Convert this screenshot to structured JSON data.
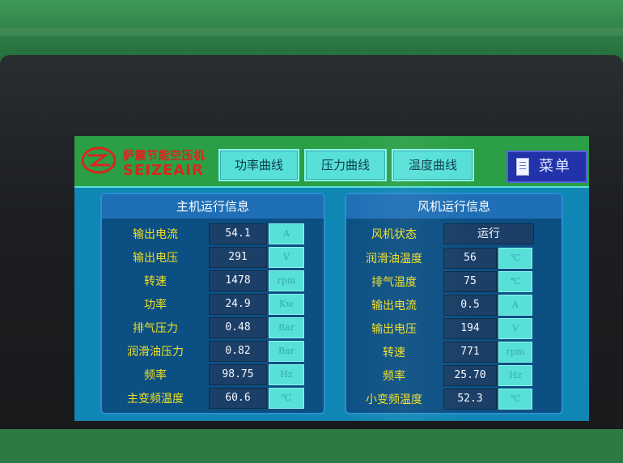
{
  "header": {
    "logo": {
      "cn": "萨震节能空压机",
      "en": "SEIZEAIR"
    },
    "tabs": [
      {
        "label": "功率曲线"
      },
      {
        "label": "压力曲线"
      },
      {
        "label": "温度曲线"
      }
    ],
    "menu_label": "菜单"
  },
  "main_panel": {
    "title": "主机运行信息",
    "rows": [
      {
        "label": "输出电流",
        "value": "54.1",
        "unit": "A"
      },
      {
        "label": "输出电压",
        "value": "291",
        "unit": "V"
      },
      {
        "label": "转速",
        "value": "1478",
        "unit": "rpm"
      },
      {
        "label": "功率",
        "value": "24.9",
        "unit": "Kw"
      },
      {
        "label": "排气压力",
        "value": "0.48",
        "unit": "Bar"
      },
      {
        "label": "润滑油压力",
        "value": "0.82",
        "unit": "Bar"
      },
      {
        "label": "频率",
        "value": "98.75",
        "unit": "Hz"
      },
      {
        "label": "主变频温度",
        "value": "60.6",
        "unit": "℃"
      }
    ]
  },
  "fan_panel": {
    "title": "风机运行信息",
    "status": {
      "label": "风机状态",
      "value": "运行"
    },
    "rows": [
      {
        "label": "润滑油温度",
        "value": "56",
        "unit": "℃"
      },
      {
        "label": "排气温度",
        "value": "75",
        "unit": "℃"
      },
      {
        "label": "输出电流",
        "value": "0.5",
        "unit": "A"
      },
      {
        "label": "输出电压",
        "value": "194",
        "unit": "V"
      },
      {
        "label": "转速",
        "value": "771",
        "unit": "rpm"
      },
      {
        "label": "频率",
        "value": "25.70",
        "unit": "Hz"
      },
      {
        "label": "小变频温度",
        "value": "52.3",
        "unit": "℃"
      }
    ]
  },
  "colors": {
    "screen_bg": "#0f86b3",
    "header_bg": "#2a9f45",
    "label_yellow": "#f2df21",
    "button_cyan": "#56e0d8",
    "menu_blue": "#2232a9",
    "logo_red": "#d9261e"
  },
  "icons": {
    "menu": "document-icon",
    "logo": "logo-mark-icon"
  }
}
